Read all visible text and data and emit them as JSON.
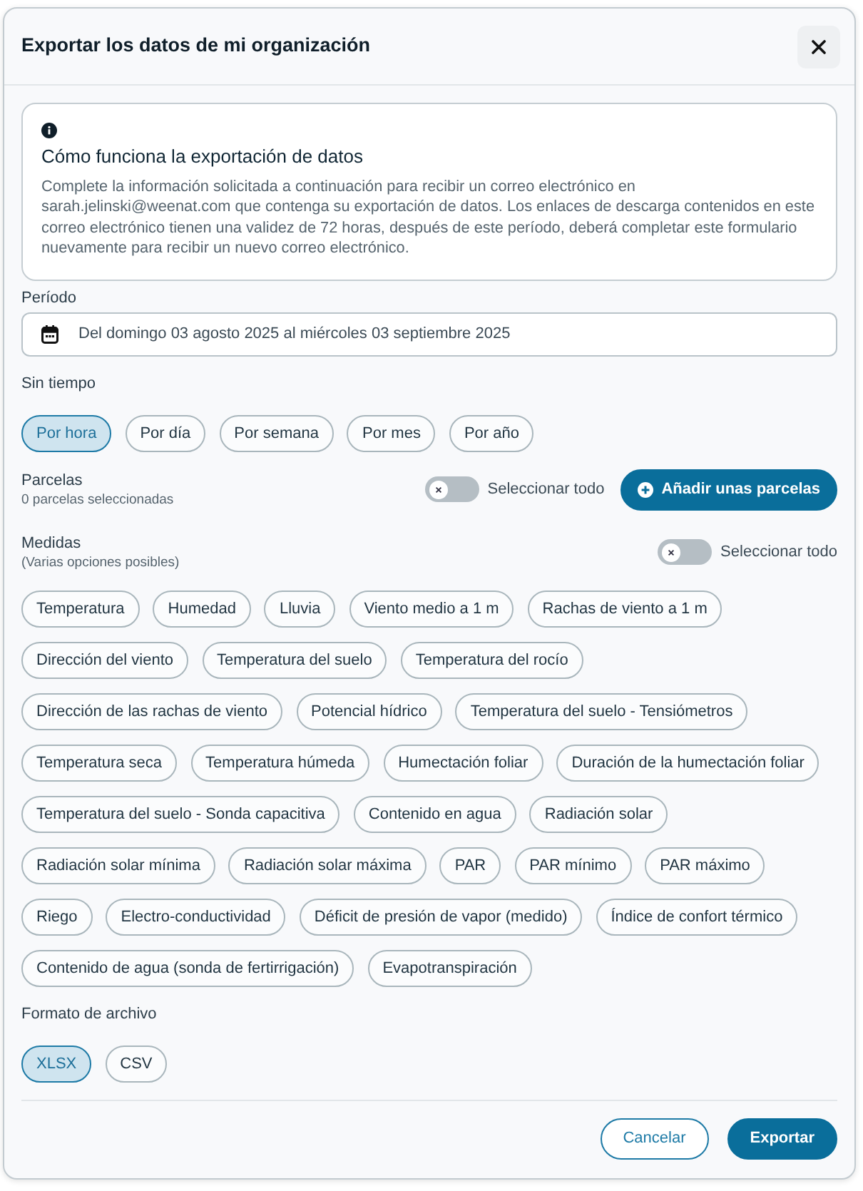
{
  "dialog": {
    "title": "Exportar los datos de mi organización"
  },
  "info": {
    "title": "Cómo funciona la exportación de datos",
    "text": "Complete la información solicitada a continuación para recibir un correo electrónico en sarah.jelinski@weenat.com que contenga su exportación de datos. Los enlaces de descarga contenidos en este correo electrónico tienen una validez de 72 horas, después de este período, deberá completar este formulario nuevamente para recibir un nuevo correo electrónico."
  },
  "period": {
    "label": "Período",
    "value": "Del domingo 03 agosto 2025 al miércoles 03 septiembre 2025"
  },
  "time_step": {
    "label": "Sin tiempo",
    "options": [
      {
        "label": "Por hora",
        "selected": true
      },
      {
        "label": "Por día",
        "selected": false
      },
      {
        "label": "Por semana",
        "selected": false
      },
      {
        "label": "Por mes",
        "selected": false
      },
      {
        "label": "Por año",
        "selected": false
      }
    ]
  },
  "plots": {
    "label": "Parcelas",
    "hint": "0 parcelas seleccionadas",
    "select_all": {
      "label": "Seleccionar todo",
      "on": false
    },
    "add_button": "Añadir unas parcelas"
  },
  "measures": {
    "label": "Medidas",
    "hint": "(Varias opciones posibles)",
    "select_all": {
      "label": "Seleccionar todo",
      "on": false
    },
    "options": [
      {
        "label": "Temperatura",
        "selected": false
      },
      {
        "label": "Humedad",
        "selected": false
      },
      {
        "label": "Lluvia",
        "selected": false
      },
      {
        "label": "Viento medio a 1 m",
        "selected": false
      },
      {
        "label": "Rachas de viento a 1 m",
        "selected": false
      },
      {
        "label": "Dirección del viento",
        "selected": false
      },
      {
        "label": "Temperatura del suelo",
        "selected": false
      },
      {
        "label": "Temperatura del rocío",
        "selected": false
      },
      {
        "label": "Dirección de las rachas de viento",
        "selected": false
      },
      {
        "label": "Potencial hídrico",
        "selected": false
      },
      {
        "label": "Temperatura del suelo - Tensiómetros",
        "selected": false
      },
      {
        "label": "Temperatura seca",
        "selected": false
      },
      {
        "label": "Temperatura húmeda",
        "selected": false
      },
      {
        "label": "Humectación foliar",
        "selected": false
      },
      {
        "label": "Duración de la humectación foliar",
        "selected": false
      },
      {
        "label": "Temperatura del suelo - Sonda capacitiva",
        "selected": false
      },
      {
        "label": "Contenido en agua",
        "selected": false
      },
      {
        "label": "Radiación solar",
        "selected": false
      },
      {
        "label": "Radiación solar mínima",
        "selected": false
      },
      {
        "label": "Radiación solar máxima",
        "selected": false
      },
      {
        "label": "PAR",
        "selected": false
      },
      {
        "label": "PAR mínimo",
        "selected": false
      },
      {
        "label": "PAR máximo",
        "selected": false
      },
      {
        "label": "Riego",
        "selected": false
      },
      {
        "label": "Electro-conductividad",
        "selected": false
      },
      {
        "label": "Déficit de presión de vapor (medido)",
        "selected": false
      },
      {
        "label": "Índice de confort térmico",
        "selected": false
      },
      {
        "label": "Contenido de agua (sonda de fertirrigación)",
        "selected": false
      },
      {
        "label": "Evapotranspiración",
        "selected": false
      }
    ]
  },
  "file_format": {
    "label": "Formato de archivo",
    "options": [
      {
        "label": "XLSX",
        "selected": true
      },
      {
        "label": "CSV",
        "selected": false
      }
    ]
  },
  "footer": {
    "buttons": [
      {
        "label": "Cancelar",
        "kind": "outline"
      },
      {
        "label": "Exportar",
        "kind": "filled"
      }
    ]
  }
}
